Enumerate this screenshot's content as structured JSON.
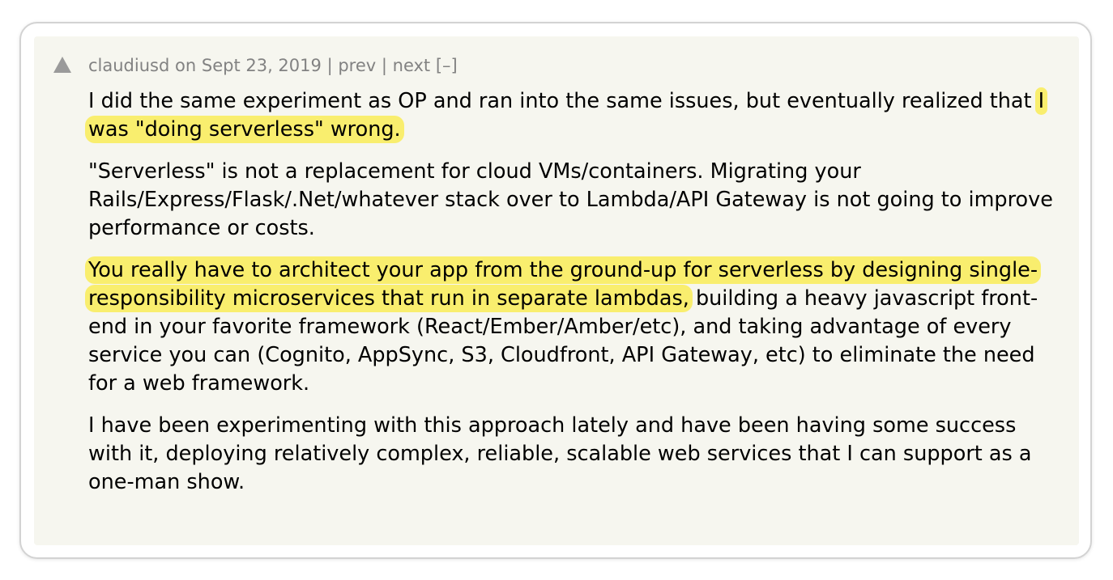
{
  "comment": {
    "author": "claudiusd",
    "on_word": "on",
    "date": "Sept 23, 2019",
    "separator": "|",
    "prev_label": "prev",
    "next_label": "next",
    "collapse_label": "[–]",
    "paragraphs": {
      "p1_text": "I did the same experiment as OP and ran into the same issues, but eventually realized that ",
      "p1_highlight": "I was \"doing serverless\" wrong.",
      "p2_text": "\"Serverless\" is not a replacement for cloud VMs/containers. Migrating your Rails/Express/Flask/.Net/whatever stack over to Lambda/API Gateway is not going to improve performance or costs.",
      "p3_highlight": "You really have to architect your app from the ground-up for serverless by designing single-responsibility microservices that run in separate lambdas,",
      "p3_text": " building a heavy javascript front-end in your favorite framework (React/Ember/Amber/etc), and taking advantage of every service you can (Cognito, AppSync, S3, Cloudfront, API Gateway, etc) to eliminate the need for a web framework.",
      "p4_text": "I have been experimenting with this approach lately and have been having some success with it, deploying relatively complex, reliable, scalable web services that I can support as a one-man show."
    }
  },
  "colors": {
    "panel_bg": "#f6f6ef",
    "meta_text": "#828282",
    "highlight": "#f9ee6e"
  },
  "icons": {
    "upvote": "upvote-triangle-icon"
  }
}
